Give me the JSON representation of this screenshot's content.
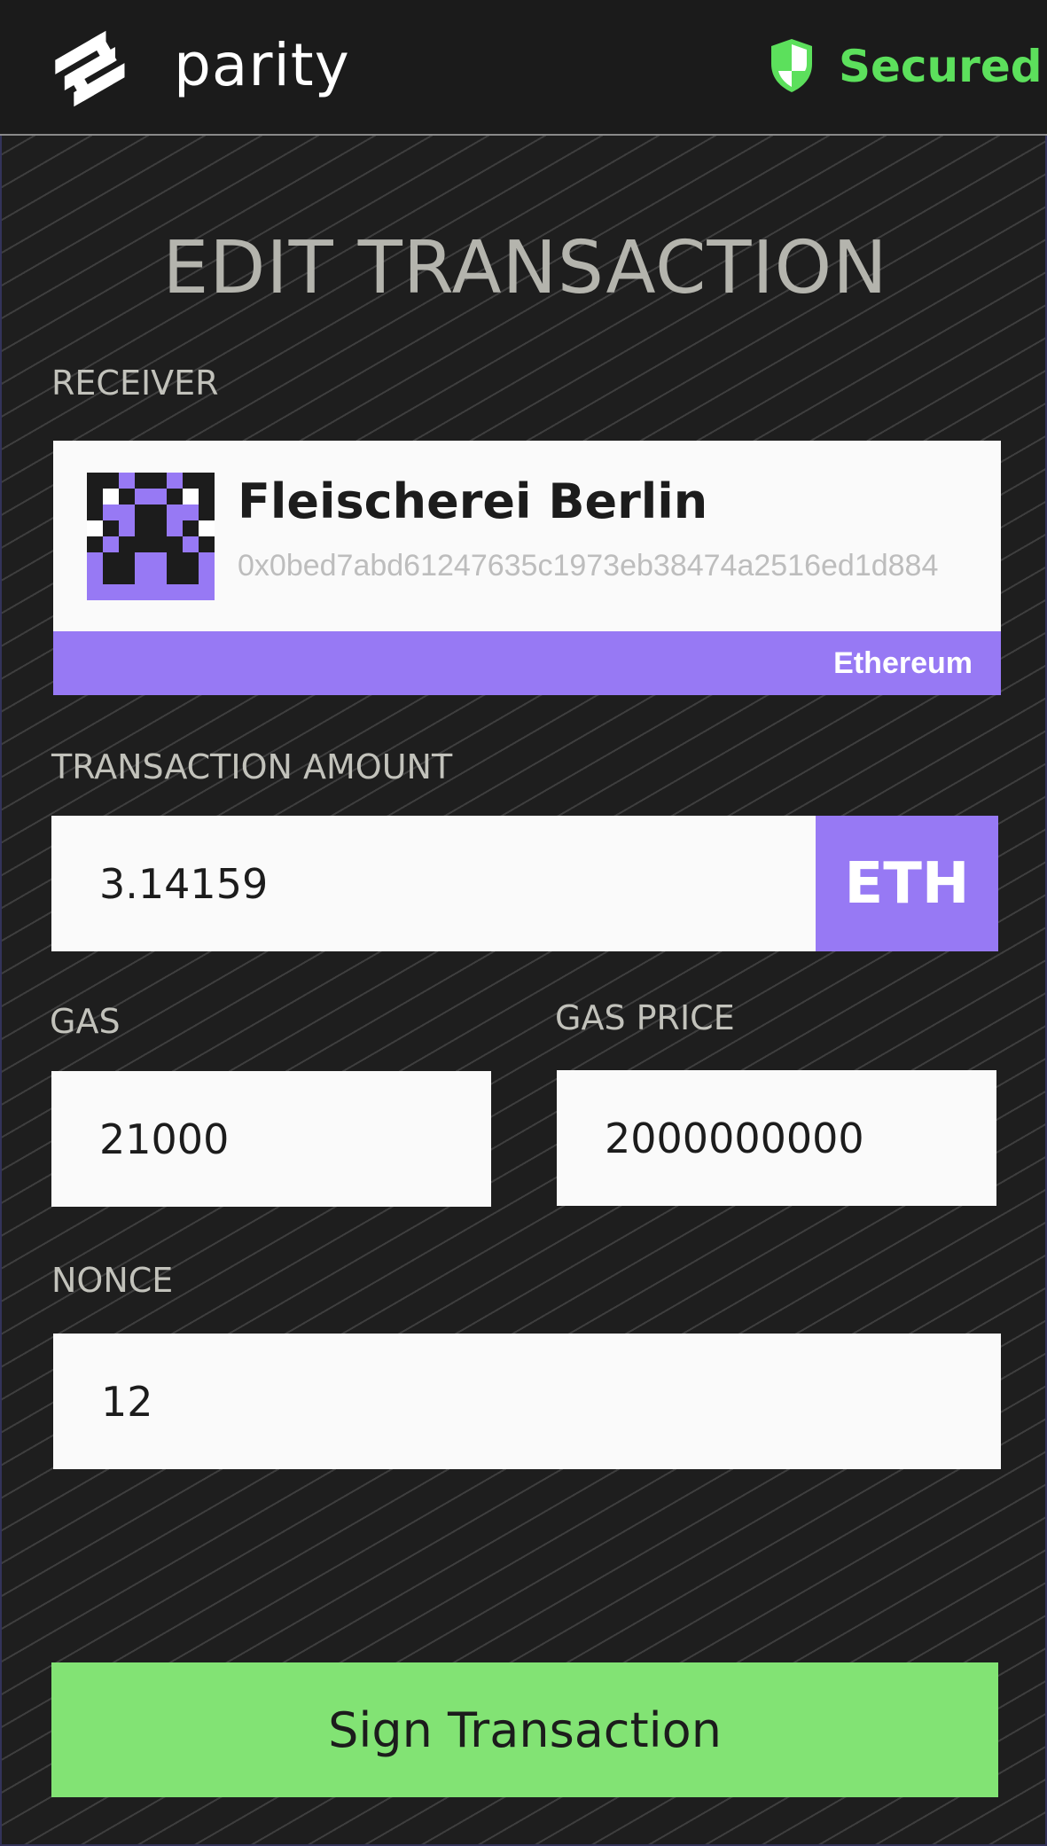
{
  "header": {
    "app_name": "parity",
    "status_label": "Secured",
    "status_color": "#5ce05c",
    "logo_icon": "parity-logo-icon",
    "status_icon": "shield-icon"
  },
  "page": {
    "title": "EDIT TRANSACTION"
  },
  "receiver": {
    "label": "RECEIVER",
    "name": "Fleischerei Berlin",
    "address": "0x0bed7abd61247635c1973eb38474a2516ed1d884",
    "network": "Ethereum",
    "network_color": "#9779f4",
    "avatar_icon": "identicon-avatar"
  },
  "amount": {
    "label": "TRANSACTION AMOUNT",
    "value": "3.14159",
    "currency": "ETH"
  },
  "gas": {
    "label": "GAS",
    "value": "21000"
  },
  "gas_price": {
    "label": "GAS PRICE",
    "value": "2000000000"
  },
  "nonce": {
    "label": "NONCE",
    "value": "12"
  },
  "actions": {
    "sign_label": "Sign Transaction",
    "sign_color": "#82e374"
  }
}
